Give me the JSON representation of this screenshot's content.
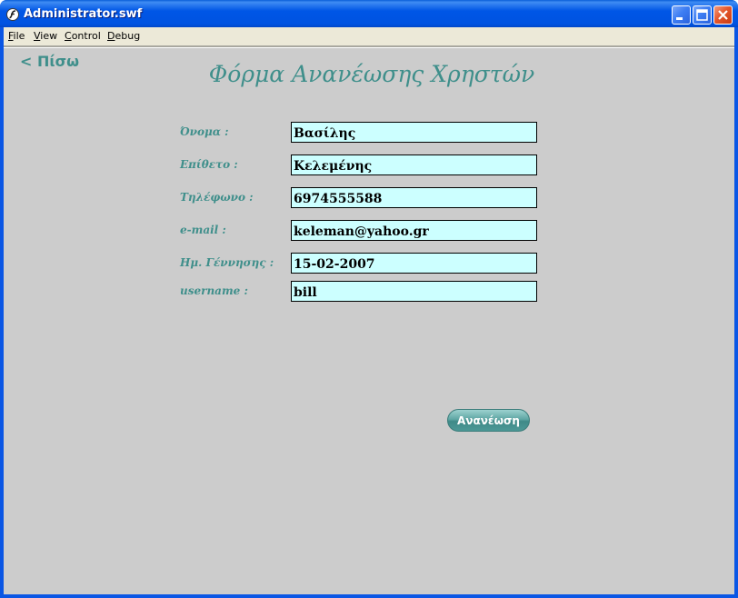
{
  "window": {
    "title": "Administrator.swf",
    "minimize_label": "Minimize",
    "maximize_label": "Maximize",
    "close_label": "Close"
  },
  "menu": {
    "items": [
      {
        "label": "File",
        "accel": "F",
        "rest": "ile"
      },
      {
        "label": "View",
        "accel": "V",
        "rest": "iew"
      },
      {
        "label": "Control",
        "accel": "C",
        "rest": "ontrol"
      },
      {
        "label": "Debug",
        "accel": "D",
        "rest": "ebug"
      }
    ]
  },
  "page": {
    "back_label": "< Πίσω",
    "title": "Φόρμα Ανανέωσης Χρηστών"
  },
  "form": {
    "fields": [
      {
        "label": "Όνομα :",
        "value": "Βασίλης"
      },
      {
        "label": "Επίθετο :",
        "value": "Κελεμένης"
      },
      {
        "label": "Τηλέφωνο :",
        "value": "6974555588"
      },
      {
        "label": "e-mail  :",
        "value": "keleman@yahoo.gr"
      },
      {
        "label": "Ημ. Γέννησης :",
        "value": "15-02-2007"
      },
      {
        "label": "username  :",
        "value": "bill"
      }
    ],
    "submit_label": "Ανανέωση"
  },
  "colors": {
    "accent": "#3f8f8b",
    "field_background": "#ccffff",
    "content_background": "#cccccc",
    "titlebar": "#0054e3"
  },
  "icons": {
    "app": "flash-player-icon",
    "minimize": "minimize-icon",
    "maximize": "maximize-icon",
    "close": "close-icon"
  }
}
